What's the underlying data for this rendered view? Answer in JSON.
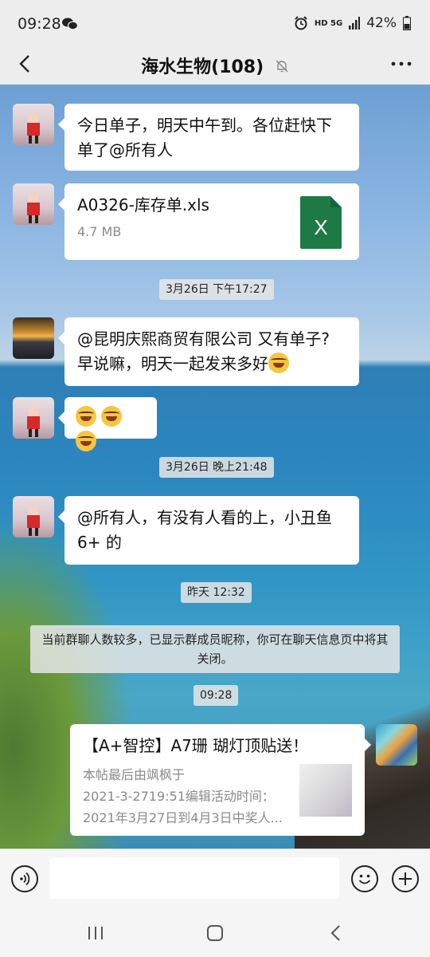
{
  "status_bar": {
    "time": "09:28",
    "network": "HD 5G",
    "battery": "42%"
  },
  "header": {
    "title": "海水生物(108)"
  },
  "messages": [
    {
      "type": "text",
      "text_line1": "今日单子，明天中午到。各位赶快下",
      "text_line2": "单了@所有人"
    },
    {
      "type": "file",
      "file_name": "A0326-库存单.xls",
      "file_size": "4.7 MB",
      "file_icon_label": "X"
    },
    {
      "type": "time",
      "text": "3月26日 下午17:27"
    },
    {
      "type": "text",
      "text_line1": "@昆明庆熙商贸有限公司  又有单子?",
      "text_line2": "早说嘛，明天一起发来多好"
    },
    {
      "type": "emoji"
    },
    {
      "type": "time",
      "text": "3月26日 晚上21:48"
    },
    {
      "type": "text",
      "text_line1": "@所有人，有没有人看的上，小丑鱼",
      "text_line2": "6+ 的"
    },
    {
      "type": "time",
      "text": "昨天 12:32"
    },
    {
      "type": "system",
      "text": "当前群聊人数较多，已显示群成员昵称，你可在聊天信息页中将其关闭。"
    },
    {
      "type": "time",
      "text": "09:28"
    },
    {
      "type": "link",
      "title": "【A+智控】A7珊 瑚灯顶贴送！",
      "desc_line1": "本帖最后由飒枫于",
      "desc_line2": "2021-3-2719:51编辑活动时间：",
      "desc_line3": "2021年3月27日到4月3日中奖人..."
    }
  ],
  "colors": {
    "chat_bubble_bg": "#ffffff",
    "header_bg": "#ededed",
    "excel_green": "#1e7a45"
  }
}
